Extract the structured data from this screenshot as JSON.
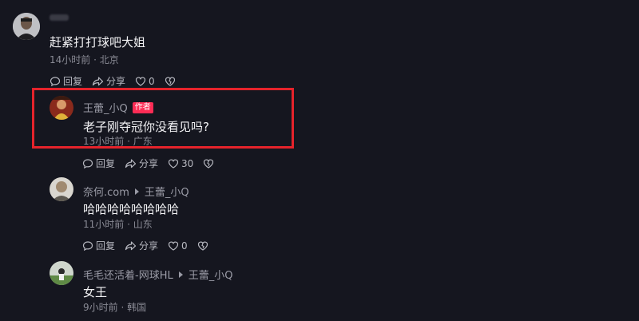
{
  "icons": {
    "reply": "reply-bubble-icon",
    "share": "share-arrow-icon",
    "like": "heart-icon",
    "dislike": "broken-heart-icon"
  },
  "colors": {
    "background": "#15161f",
    "author_badge": "#fe2c55",
    "highlight": "#e5232b"
  },
  "comments": [
    {
      "username": "",
      "text": "赶紧打打球吧大姐",
      "meta": "14小时前 · 北京",
      "reply_label": "回复",
      "share_label": "分享",
      "like_count": "0"
    },
    {
      "username": "王蕾_小Q",
      "badge": "作者",
      "text": "老子刚夺冠你没看见吗?",
      "meta": "13小时前 · 广东",
      "reply_label": "回复",
      "share_label": "分享",
      "like_count": "30"
    },
    {
      "username": "奈何.com",
      "reply_to": "王蕾_小Q",
      "text": "哈哈哈哈哈哈哈哈",
      "meta": "11小时前 · 山东",
      "reply_label": "回复",
      "share_label": "分享",
      "like_count": "0"
    },
    {
      "username": "毛毛还活着-网球HL",
      "reply_to": "王蕾_小Q",
      "text": "女王",
      "meta": "9小时前 · 韩国"
    }
  ]
}
